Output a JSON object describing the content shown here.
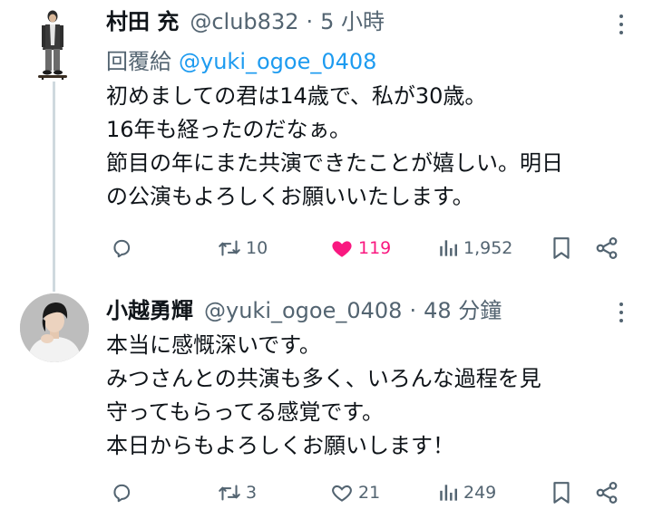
{
  "tweets": [
    {
      "name": "村田 充",
      "handle": "@club832",
      "separator": "·",
      "time": "5 小時",
      "reply_prefix": "回覆給",
      "reply_handle": "@yuki_ogoe_0408",
      "lines": [
        "初めましての君は14歳で、私が30歳。",
        "16年も経ったのだなぁ。",
        "節目の年にまた共演できたことが嬉しい。明日",
        "の公演もよろしくお願いいたします。"
      ],
      "retweets": "10",
      "likes": "119",
      "liked": true,
      "views": "1,952"
    },
    {
      "name": "小越勇輝",
      "handle": "@yuki_ogoe_0408",
      "separator": "·",
      "time": "48 分鐘",
      "lines": [
        "本当に感慨深いです。",
        "みつさんとの共演も多く、いろんな過程を見",
        "守ってもらってる感覚です。",
        "本日からもよろしくお願いします！"
      ],
      "retweets": "3",
      "likes": "21",
      "liked": false,
      "views": "249"
    }
  ],
  "icons": {
    "reply": "reply-icon",
    "retweet": "retweet-icon",
    "like": "heart-icon",
    "views": "views-icon",
    "bookmark": "bookmark-icon",
    "share": "share-icon",
    "more": "more-icon"
  },
  "colors": {
    "text": "#0f1419",
    "secondary": "#536471",
    "link": "#1d9bf0",
    "like": "#f91880",
    "thread_line": "#cfd9de"
  }
}
